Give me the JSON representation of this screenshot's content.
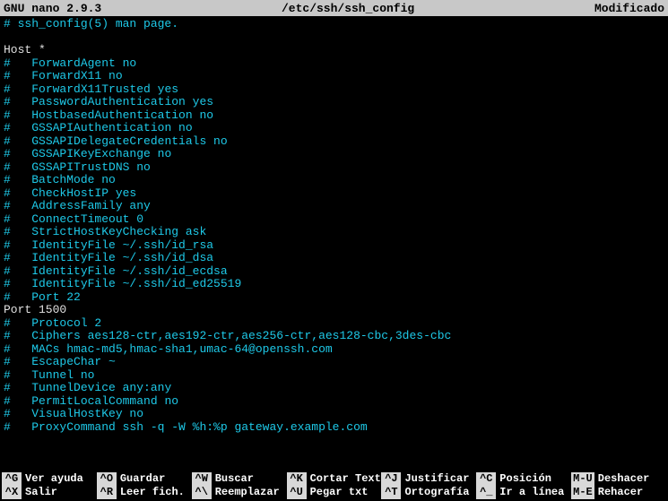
{
  "titlebar": {
    "app": "GNU nano 2.9.3",
    "file": "/etc/ssh/ssh_config",
    "status": "Modificado"
  },
  "lines": [
    {
      "prefix": "# ",
      "text": "ssh_config(5) man page.",
      "style": "opt"
    },
    {
      "prefix": "",
      "text": "",
      "style": "plain"
    },
    {
      "prefix": "",
      "text": "Host *",
      "style": "plain"
    },
    {
      "prefix": "#   ",
      "text": "ForwardAgent no",
      "style": "opt"
    },
    {
      "prefix": "#   ",
      "text": "ForwardX11 no",
      "style": "opt"
    },
    {
      "prefix": "#   ",
      "text": "ForwardX11Trusted yes",
      "style": "opt"
    },
    {
      "prefix": "#   ",
      "text": "PasswordAuthentication yes",
      "style": "opt"
    },
    {
      "prefix": "#   ",
      "text": "HostbasedAuthentication no",
      "style": "opt"
    },
    {
      "prefix": "#   ",
      "text": "GSSAPIAuthentication no",
      "style": "opt"
    },
    {
      "prefix": "#   ",
      "text": "GSSAPIDelegateCredentials no",
      "style": "opt"
    },
    {
      "prefix": "#   ",
      "text": "GSSAPIKeyExchange no",
      "style": "opt"
    },
    {
      "prefix": "#   ",
      "text": "GSSAPITrustDNS no",
      "style": "opt"
    },
    {
      "prefix": "#   ",
      "text": "BatchMode no",
      "style": "opt"
    },
    {
      "prefix": "#   ",
      "text": "CheckHostIP yes",
      "style": "opt"
    },
    {
      "prefix": "#   ",
      "text": "AddressFamily any",
      "style": "opt"
    },
    {
      "prefix": "#   ",
      "text": "ConnectTimeout 0",
      "style": "opt"
    },
    {
      "prefix": "#   ",
      "text": "StrictHostKeyChecking ask",
      "style": "opt"
    },
    {
      "prefix": "#   ",
      "text": "IdentityFile ~/.ssh/id_rsa",
      "style": "opt"
    },
    {
      "prefix": "#   ",
      "text": "IdentityFile ~/.ssh/id_dsa",
      "style": "opt"
    },
    {
      "prefix": "#   ",
      "text": "IdentityFile ~/.ssh/id_ecdsa",
      "style": "opt"
    },
    {
      "prefix": "#   ",
      "text": "IdentityFile ~/.ssh/id_ed25519",
      "style": "opt"
    },
    {
      "prefix": "#   ",
      "text": "Port 22",
      "style": "opt"
    },
    {
      "prefix": "",
      "text": "Port 1500",
      "style": "plain"
    },
    {
      "prefix": "#   ",
      "text": "Protocol 2",
      "style": "opt"
    },
    {
      "prefix": "#   ",
      "text": "Ciphers aes128-ctr,aes192-ctr,aes256-ctr,aes128-cbc,3des-cbc",
      "style": "opt"
    },
    {
      "prefix": "#   ",
      "text": "MACs hmac-md5,hmac-sha1,umac-64@openssh.com",
      "style": "opt"
    },
    {
      "prefix": "#   ",
      "text": "EscapeChar ~",
      "style": "opt"
    },
    {
      "prefix": "#   ",
      "text": "Tunnel no",
      "style": "opt"
    },
    {
      "prefix": "#   ",
      "text": "TunnelDevice any:any",
      "style": "opt"
    },
    {
      "prefix": "#   ",
      "text": "PermitLocalCommand no",
      "style": "opt"
    },
    {
      "prefix": "#   ",
      "text": "VisualHostKey no",
      "style": "opt"
    },
    {
      "prefix": "#   ",
      "text": "ProxyCommand ssh -q -W %h:%p gateway.example.com",
      "style": "opt"
    }
  ],
  "footer": {
    "row1": [
      {
        "key": "^G",
        "label": "Ver ayuda"
      },
      {
        "key": "^O",
        "label": "Guardar"
      },
      {
        "key": "^W",
        "label": "Buscar"
      },
      {
        "key": "^K",
        "label": "Cortar Text"
      },
      {
        "key": "^J",
        "label": "Justificar"
      },
      {
        "key": "^C",
        "label": "Posición"
      },
      {
        "key": "M-U",
        "label": "Deshacer"
      }
    ],
    "row2": [
      {
        "key": "^X",
        "label": "Salir"
      },
      {
        "key": "^R",
        "label": "Leer fich."
      },
      {
        "key": "^\\",
        "label": "Reemplazar"
      },
      {
        "key": "^U",
        "label": "Pegar txt"
      },
      {
        "key": "^T",
        "label": "Ortografía"
      },
      {
        "key": "^_",
        "label": "Ir a línea"
      },
      {
        "key": "M-E",
        "label": "Rehacer"
      }
    ]
  }
}
